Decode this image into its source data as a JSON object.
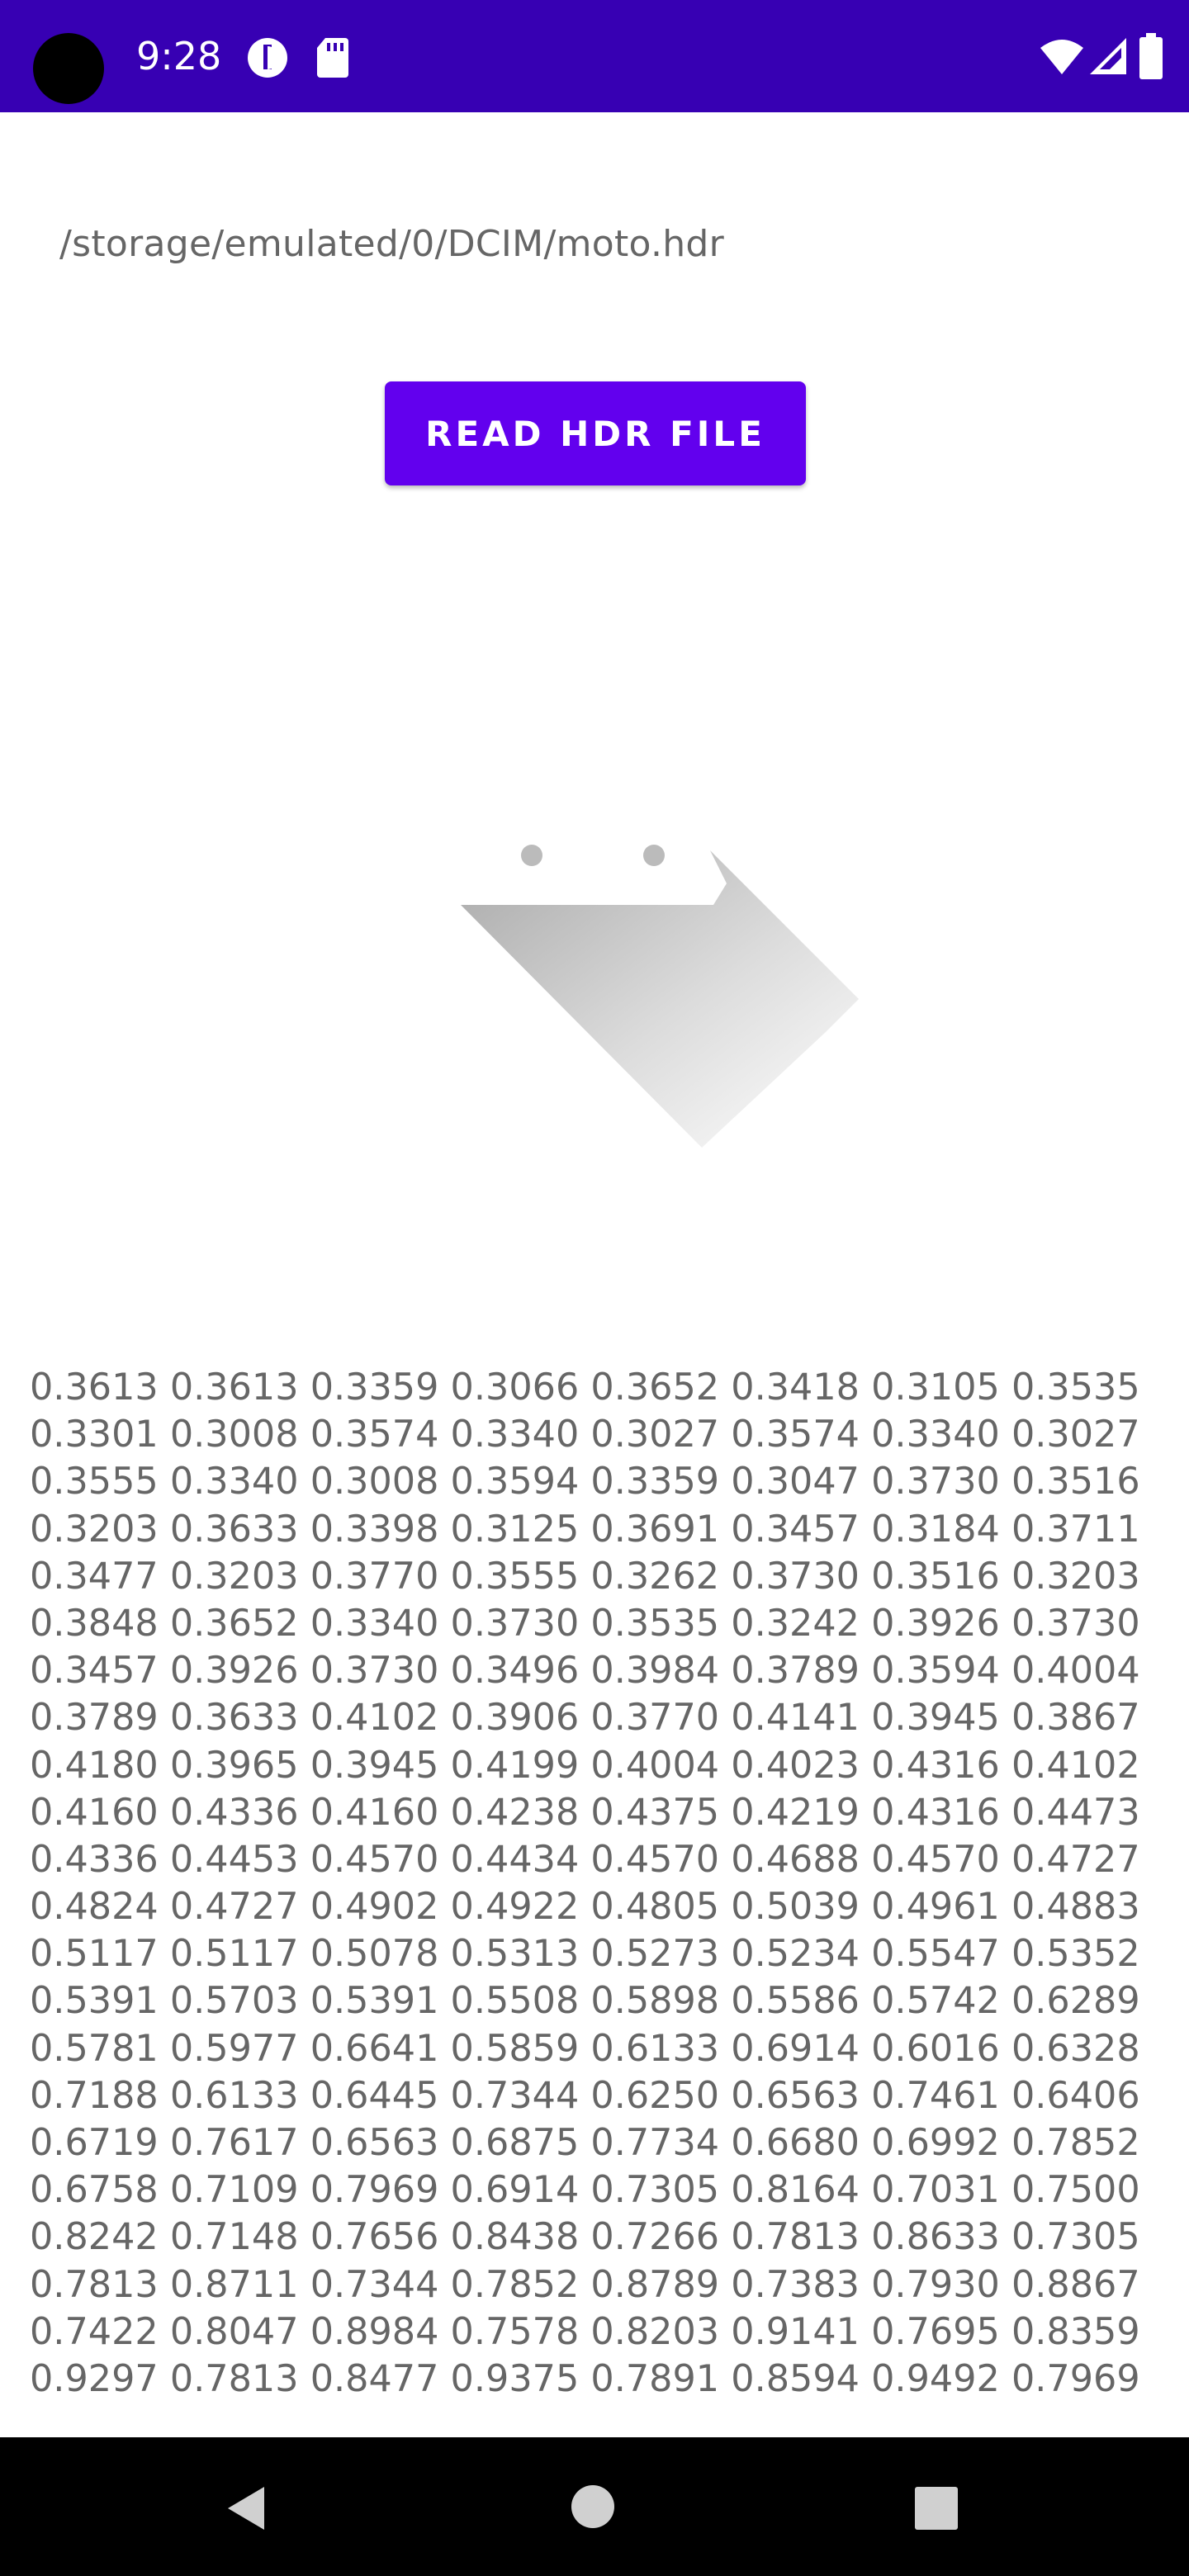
{
  "status_bar": {
    "time": "9:28",
    "background_color": "#3700b3",
    "icons_left": [
      "data-saver-icon",
      "sd-card-icon"
    ],
    "icons_right": [
      "wifi-icon",
      "cellular-signal-icon",
      "battery-icon"
    ]
  },
  "main": {
    "file_path": "/storage/emulated/0/DCIM/moto.hdr",
    "read_button_label": "READ HDR FILE",
    "accent_color": "#6200ee",
    "image_preview_icon": "hdr-image-preview",
    "pixel_values": [
      "0.3613 0.3613 0.3359 0.3066 0.3652 0.3418 0.3105 0.3535",
      "0.3301 0.3008 0.3574 0.3340 0.3027 0.3574 0.3340 0.3027",
      "0.3555 0.3340 0.3008 0.3594 0.3359 0.3047 0.3730 0.3516",
      "0.3203 0.3633 0.3398 0.3125 0.3691 0.3457 0.3184 0.3711",
      "0.3477 0.3203 0.3770 0.3555 0.3262 0.3730 0.3516 0.3203",
      "0.3848 0.3652 0.3340 0.3730 0.3535 0.3242 0.3926 0.3730",
      "0.3457 0.3926 0.3730 0.3496 0.3984 0.3789 0.3594 0.4004",
      "0.3789 0.3633 0.4102 0.3906 0.3770 0.4141 0.3945 0.3867",
      "0.4180 0.3965 0.3945 0.4199 0.4004 0.4023 0.4316 0.4102",
      "0.4160 0.4336 0.4160 0.4238 0.4375 0.4219 0.4316 0.4473",
      "0.4336 0.4453 0.4570 0.4434 0.4570 0.4688 0.4570 0.4727",
      "0.4824 0.4727 0.4902 0.4922 0.4805 0.5039 0.4961 0.4883",
      "0.5117 0.5117 0.5078 0.5313 0.5273 0.5234 0.5547 0.5352",
      "0.5391 0.5703 0.5391 0.5508 0.5898 0.5586 0.5742 0.6289",
      "0.5781 0.5977 0.6641 0.5859 0.6133 0.6914 0.6016 0.6328",
      "0.7188 0.6133 0.6445 0.7344 0.6250 0.6563 0.7461 0.6406",
      "0.6719 0.7617 0.6563 0.6875 0.7734 0.6680 0.6992 0.7852",
      "0.6758 0.7109 0.7969 0.6914 0.7305 0.8164 0.7031 0.7500",
      "0.8242 0.7148 0.7656 0.8438 0.7266 0.7813 0.8633 0.7305",
      "0.7813 0.8711 0.7344 0.7852 0.8789 0.7383 0.7930 0.8867",
      "0.7422 0.8047 0.8984 0.7578 0.8203 0.9141 0.7695 0.8359",
      "0.9297 0.7813 0.8477 0.9375 0.7891 0.8594 0.9492 0.7969"
    ]
  },
  "nav_bar": {
    "buttons": [
      "back-icon",
      "home-icon",
      "recents-icon"
    ]
  }
}
